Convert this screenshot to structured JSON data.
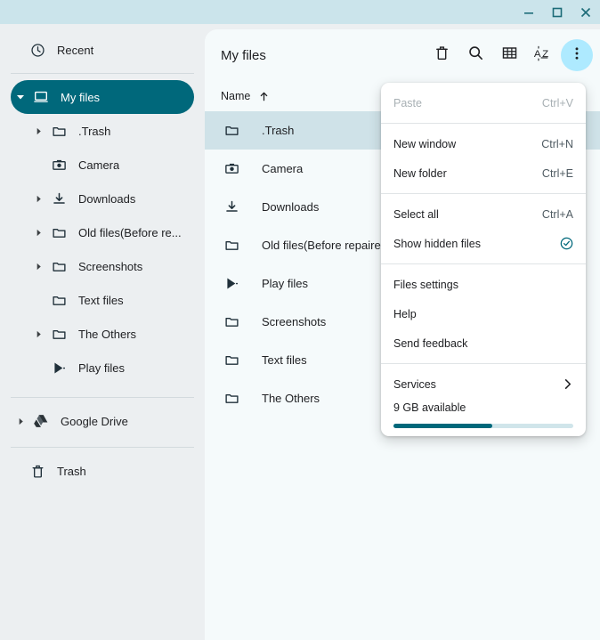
{
  "window": {
    "controls": [
      {
        "name": "minimize",
        "glyph": "minimize-icon"
      },
      {
        "name": "maximize",
        "glyph": "maximize-icon"
      },
      {
        "name": "close",
        "glyph": "close-icon"
      }
    ]
  },
  "sidebar": {
    "items": [
      {
        "label": "Recent",
        "icon": "clock-icon",
        "level": 0,
        "twisty": "none",
        "selected": false
      },
      {
        "label": "My files",
        "icon": "device-icon",
        "level": 0,
        "twisty": "expanded",
        "selected": true
      },
      {
        "label": ".Trash",
        "icon": "folder-icon",
        "level": 1,
        "twisty": "collapsed",
        "selected": false
      },
      {
        "label": "Camera",
        "icon": "camera-icon",
        "level": 1,
        "twisty": "none",
        "selected": false
      },
      {
        "label": "Downloads",
        "icon": "download-icon",
        "level": 1,
        "twisty": "collapsed",
        "selected": false
      },
      {
        "label": "Old files(Before re...",
        "icon": "folder-icon",
        "level": 1,
        "twisty": "collapsed",
        "selected": false
      },
      {
        "label": "Screenshots",
        "icon": "folder-icon",
        "level": 1,
        "twisty": "collapsed",
        "selected": false
      },
      {
        "label": "Text files",
        "icon": "folder-icon",
        "level": 1,
        "twisty": "none",
        "selected": false
      },
      {
        "label": "The Others",
        "icon": "folder-icon",
        "level": 1,
        "twisty": "collapsed",
        "selected": false
      },
      {
        "label": "Play files",
        "icon": "play-store-icon",
        "level": 1,
        "twisty": "none",
        "selected": false
      }
    ],
    "drive": {
      "label": "Google Drive",
      "icon": "google-drive-icon",
      "twisty": "collapsed"
    },
    "trash": {
      "label": "Trash",
      "icon": "trash-icon"
    }
  },
  "main": {
    "title": "My files",
    "toolbar": [
      {
        "name": "delete-icon",
        "label": "Delete",
        "active": false
      },
      {
        "name": "search-icon",
        "label": "Search",
        "active": false
      },
      {
        "name": "grid-view-icon",
        "label": "Switch to grid view",
        "active": false
      },
      {
        "name": "sort-az-icon",
        "label": "Sort",
        "active": false
      },
      {
        "name": "more-options-icon",
        "label": "More options",
        "active": true
      }
    ],
    "columns": [
      {
        "label": "Name",
        "sort": "ascending"
      }
    ],
    "rows": [
      {
        "name": ".Trash",
        "icon": "folder-icon",
        "selected": true
      },
      {
        "name": "Camera",
        "icon": "camera-icon",
        "selected": false
      },
      {
        "name": "Downloads",
        "icon": "download-icon",
        "selected": false
      },
      {
        "name": "Old files(Before repaired)",
        "icon": "folder-icon",
        "selected": false
      },
      {
        "name": "Play files",
        "icon": "play-store-icon",
        "selected": false
      },
      {
        "name": "Screenshots",
        "icon": "folder-icon",
        "selected": false
      },
      {
        "name": "Text files",
        "icon": "folder-icon",
        "selected": false
      },
      {
        "name": "The Others",
        "icon": "folder-icon",
        "selected": false
      }
    ]
  },
  "menu": {
    "items": [
      {
        "label": "Paste",
        "accel": "Ctrl+V",
        "disabled": true,
        "type": "item"
      },
      {
        "type": "divider"
      },
      {
        "label": "New window",
        "accel": "Ctrl+N",
        "disabled": false,
        "type": "item"
      },
      {
        "label": "New folder",
        "accel": "Ctrl+E",
        "disabled": false,
        "type": "item"
      },
      {
        "type": "divider"
      },
      {
        "label": "Select all",
        "accel": "Ctrl+A",
        "disabled": false,
        "type": "item"
      },
      {
        "label": "Show hidden files",
        "accel": "",
        "disabled": false,
        "type": "check",
        "checked": true
      },
      {
        "type": "divider"
      },
      {
        "label": "Files settings",
        "accel": "",
        "disabled": false,
        "type": "item"
      },
      {
        "label": "Help",
        "accel": "",
        "disabled": false,
        "type": "item"
      },
      {
        "label": "Send feedback",
        "accel": "",
        "disabled": false,
        "type": "item"
      },
      {
        "type": "divider"
      },
      {
        "label": "Services",
        "accel": "",
        "disabled": false,
        "type": "submenu"
      }
    ],
    "storage": {
      "label": "9 GB available",
      "percent": 55
    }
  },
  "colors": {
    "titlebar": "#cbe4eb",
    "sidebar": "#eceff1",
    "panel": "#f5fafb",
    "accent": "#00687b",
    "selection": "#cfe2e8",
    "active_tool": "#aeeaff"
  }
}
